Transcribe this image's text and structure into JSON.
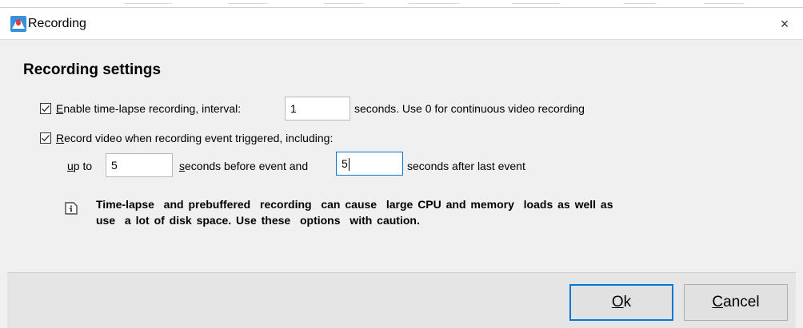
{
  "window": {
    "title": "Recording",
    "close_glyph": "×"
  },
  "settings": {
    "heading": "Recording settings",
    "timelapse": {
      "checked": true,
      "mnemonic": "E",
      "label_rest": "nable time-lapse recording, interval:",
      "interval_value": "1",
      "suffix": "seconds. Use 0 for continuous video recording"
    },
    "event_recording": {
      "checked": true,
      "mnemonic": "R",
      "label_rest": "ecord video when recording event triggered, including:",
      "up_to_mnemonic": "u",
      "up_to_rest": "p to",
      "before_value": "5",
      "before_mnemonic": "s",
      "before_rest": "econds before event and",
      "after_value": "5",
      "after_suffix": "seconds after last event"
    },
    "warning_line1": "Time-lapse  and prebuffered  recording  can cause  large CPU and memory  loads as well as",
    "warning_line2": "use  a lot of disk space. Use these  options  with caution."
  },
  "footer": {
    "ok_mnemonic": "O",
    "ok_rest": "k",
    "cancel_mnemonic": "C",
    "cancel_rest": "ancel"
  },
  "colors": {
    "accent": "#0078d7",
    "dialog_bg": "#f0f0f0",
    "footer_bg": "#e5e5e5"
  }
}
